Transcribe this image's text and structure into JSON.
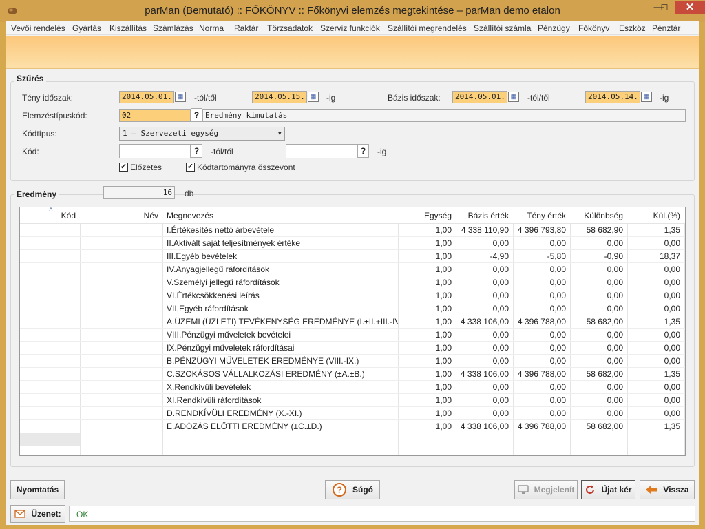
{
  "window": {
    "title": "parMan (Bemutató) :: FŐKÖNYV :: Főkönyvi elemzés megtekintése   –   parMan demo etalon",
    "minimize": "—",
    "maximize": "☐",
    "close": "✕"
  },
  "menu": [
    "Vevői rendelés",
    "Gyártás",
    "Kiszállítás",
    "Számlázás",
    "Norma",
    "Raktár",
    "Törzsadatok",
    "Szerviz funkciók",
    "Szállítói megrendelés",
    "Szállítói számla",
    "Pénzügy",
    "Főkönyv",
    "Eszköz",
    "Pénztár"
  ],
  "filter": {
    "title": "Szűrés",
    "teny_label": "Tény időszak:",
    "teny_from": "2014.05.01.",
    "tol": "-tól/től",
    "teny_to": "2014.05.15.",
    "ig": "-ig",
    "bazis_label": "Bázis időszak:",
    "bazis_from": "2014.05.01.",
    "bazis_to": "2014.05.14.",
    "elemzes_label": "Elemzéstípuskód:",
    "elemzes_code": "02",
    "elemzes_name": "Eredmény kimutatás",
    "kodtipus_label": "Kódtípus:",
    "kodtipus_value": "1 – Szervezeti egység",
    "kod_label": "Kód:",
    "kod_from": "",
    "kod_to": "",
    "help": "?",
    "elozetes_label": "Előzetes",
    "osszevont_label": "Kódtartományra összevont",
    "elozetes_checked": "✓",
    "osszevont_checked": "✓"
  },
  "result": {
    "title": "Eredmény",
    "count": "16",
    "unit": "db",
    "sort_indicator": "˄",
    "columns": [
      "Kód",
      "Név",
      "Megnevezés",
      "Egység",
      "Bázis érték",
      "Tény érték",
      "Különbség",
      "Kül.(%)"
    ],
    "rows": [
      {
        "kod": "",
        "nev": "",
        "megnevezes": "I.Értékesítés nettó árbevétele",
        "egyseg": "1,00",
        "bazis": "4 338 110,90",
        "teny": "4 396 793,80",
        "kulonbseg": "58 682,90",
        "kul_pct": "1,35"
      },
      {
        "kod": "",
        "nev": "",
        "megnevezes": "II.Aktivált saját teljesítmények értéke",
        "egyseg": "1,00",
        "bazis": "0,00",
        "teny": "0,00",
        "kulonbseg": "0,00",
        "kul_pct": "0,00"
      },
      {
        "kod": "",
        "nev": "",
        "megnevezes": "III.Egyéb bevételek",
        "egyseg": "1,00",
        "bazis": "-4,90",
        "teny": "-5,80",
        "kulonbseg": "-0,90",
        "kul_pct": "18,37"
      },
      {
        "kod": "",
        "nev": "",
        "megnevezes": "IV.Anyagjellegű ráfordítások",
        "egyseg": "1,00",
        "bazis": "0,00",
        "teny": "0,00",
        "kulonbseg": "0,00",
        "kul_pct": "0,00"
      },
      {
        "kod": "",
        "nev": "",
        "megnevezes": "V.Személyi jellegű ráfordítások",
        "egyseg": "1,00",
        "bazis": "0,00",
        "teny": "0,00",
        "kulonbseg": "0,00",
        "kul_pct": "0,00"
      },
      {
        "kod": "",
        "nev": "",
        "megnevezes": "VI.Értékcsökkenési leírás",
        "egyseg": "1,00",
        "bazis": "0,00",
        "teny": "0,00",
        "kulonbseg": "0,00",
        "kul_pct": "0,00"
      },
      {
        "kod": "",
        "nev": "",
        "megnevezes": "VII.Egyéb ráfordítások",
        "egyseg": "1,00",
        "bazis": "0,00",
        "teny": "0,00",
        "kulonbseg": "0,00",
        "kul_pct": "0,00"
      },
      {
        "kod": "",
        "nev": "",
        "megnevezes": "A.ÜZEMI (ÜZLETI) TEVÉKENYSÉG EREDMÉNYE (I.±II.+III.-IV.-...",
        "egyseg": "1,00",
        "bazis": "4 338 106,00",
        "teny": "4 396 788,00",
        "kulonbseg": "58 682,00",
        "kul_pct": "1,35"
      },
      {
        "kod": "",
        "nev": "",
        "megnevezes": "VIII.Pénzügyi műveletek bevételei",
        "egyseg": "1,00",
        "bazis": "0,00",
        "teny": "0,00",
        "kulonbseg": "0,00",
        "kul_pct": "0,00"
      },
      {
        "kod": "",
        "nev": "",
        "megnevezes": "IX.Pénzügyi műveletek ráfordításai",
        "egyseg": "1,00",
        "bazis": "0,00",
        "teny": "0,00",
        "kulonbseg": "0,00",
        "kul_pct": "0,00"
      },
      {
        "kod": "",
        "nev": "",
        "megnevezes": "B.PÉNZÜGYI MŰVELETEK EREDMÉNYE (VIII.-IX.)",
        "egyseg": "1,00",
        "bazis": "0,00",
        "teny": "0,00",
        "kulonbseg": "0,00",
        "kul_pct": "0,00"
      },
      {
        "kod": "",
        "nev": "",
        "megnevezes": "C.SZOKÁSOS VÁLLALKOZÁSI EREDMÉNY (±A.±B.)",
        "egyseg": "1,00",
        "bazis": "4 338 106,00",
        "teny": "4 396 788,00",
        "kulonbseg": "58 682,00",
        "kul_pct": "1,35"
      },
      {
        "kod": "",
        "nev": "",
        "megnevezes": "X.Rendkívüli bevételek",
        "egyseg": "1,00",
        "bazis": "0,00",
        "teny": "0,00",
        "kulonbseg": "0,00",
        "kul_pct": "0,00"
      },
      {
        "kod": "",
        "nev": "",
        "megnevezes": "XI.Rendkívüli ráfordítások",
        "egyseg": "1,00",
        "bazis": "0,00",
        "teny": "0,00",
        "kulonbseg": "0,00",
        "kul_pct": "0,00"
      },
      {
        "kod": "",
        "nev": "",
        "megnevezes": "D.RENDKÍVÜLI EREDMÉNY (X.-XI.)",
        "egyseg": "1,00",
        "bazis": "0,00",
        "teny": "0,00",
        "kulonbseg": "0,00",
        "kul_pct": "0,00"
      },
      {
        "kod": "",
        "nev": "",
        "megnevezes": "E.ADÓZÁS ELŐTTI EREDMÉNY (±C.±D.)",
        "egyseg": "1,00",
        "bazis": "4 338 106,00",
        "teny": "4 396 788,00",
        "kulonbseg": "58 682,00",
        "kul_pct": "1,35"
      }
    ]
  },
  "buttons": {
    "print": "Nyomtatás",
    "help": "Súgó",
    "display": "Megjelenít",
    "refresh": "Újat kér",
    "back": "Vissza"
  },
  "message": {
    "label": "Üzenet:",
    "text": "OK"
  },
  "colors": {
    "titlebar": "#d3a24e",
    "highlight_field": "#fccf7a",
    "banner": "#fcc77b",
    "close_button": "#c74a3a",
    "message_ok": "#2e7d32"
  }
}
